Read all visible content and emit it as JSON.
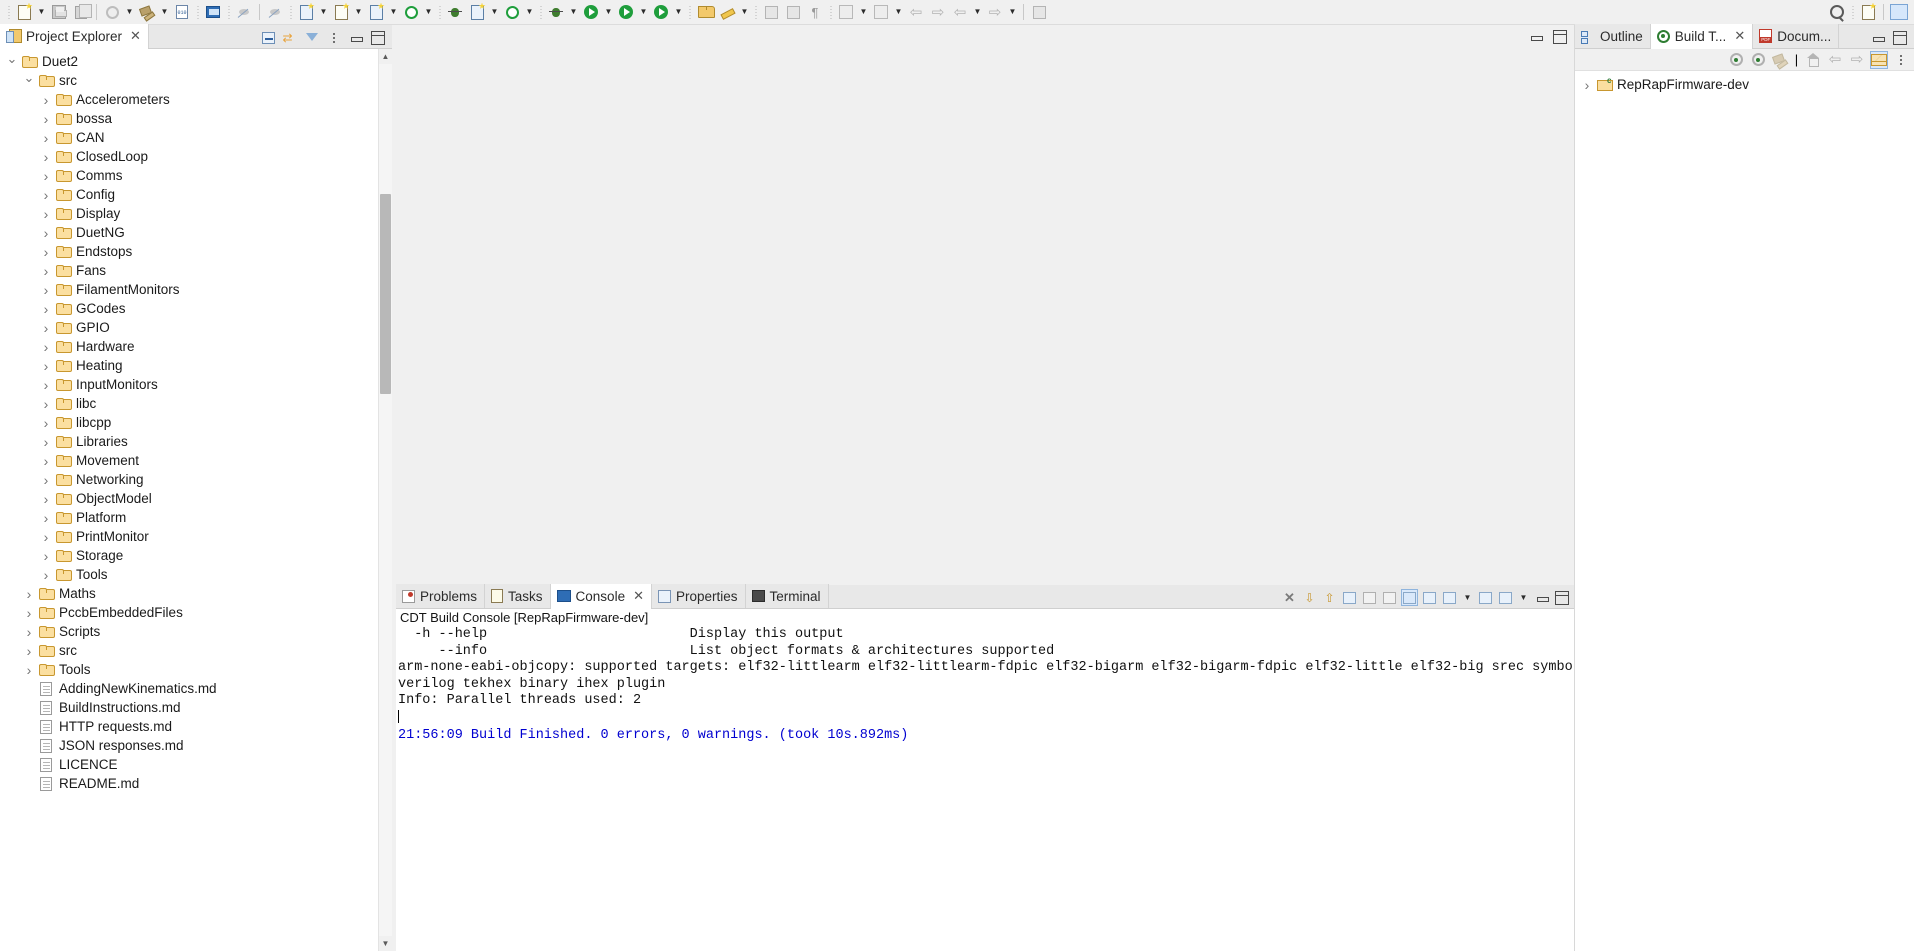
{
  "toolbar": {
    "items": [
      {
        "name": "new-wizard-icon",
        "glyph": "new-doc",
        "dropdown": true
      },
      {
        "name": "save-icon",
        "glyph": "floppy",
        "dropdown": false
      },
      {
        "name": "save-all-icon",
        "glyph": "copy",
        "dropdown": false
      },
      {
        "name": "build-all-icon",
        "glyph": "circleg",
        "dropdown": true
      },
      {
        "name": "build-hammer-icon",
        "glyph": "hammer",
        "dropdown": true
      },
      {
        "name": "binary-010-icon",
        "glyph": "bin010",
        "dropdown": false
      },
      {
        "name": "open-console-icon",
        "glyph": "monitor",
        "dropdown": false
      },
      {
        "name": "skip-breakpoints-icon",
        "glyph": "nodebug",
        "dropdown": false
      },
      {
        "name": "debug-step-icon",
        "glyph": "stepicon",
        "dropdown": false
      },
      {
        "name": "new-c-class-icon",
        "glyph": "doc-c",
        "dropdown": true
      },
      {
        "name": "new-c-source-folder-icon",
        "glyph": "doc-c2",
        "dropdown": true
      },
      {
        "name": "new-c-file-icon",
        "glyph": "doc-c3",
        "dropdown": true
      },
      {
        "name": "search-g-icon",
        "glyph": "g-star",
        "dropdown": true
      },
      {
        "name": "new-c-project-icon",
        "glyph": "doc-c4",
        "dropdown": true
      },
      {
        "name": "g-plugin-icon",
        "glyph": "g-star2",
        "dropdown": true
      },
      {
        "name": "debug-bug-icon",
        "glyph": "bug",
        "dropdown": true
      },
      {
        "name": "run-icon",
        "glyph": "run",
        "dropdown": true
      },
      {
        "name": "run-external-tools-icon",
        "glyph": "run-w",
        "dropdown": true
      },
      {
        "name": "run-config-icon",
        "glyph": "run-red",
        "dropdown": true
      },
      {
        "name": "open-resource-icon",
        "glyph": "folderopen",
        "dropdown": false
      },
      {
        "name": "edit-pencil-icon",
        "glyph": "pencil",
        "dropdown": true
      },
      {
        "name": "new-editor-icon",
        "glyph": "grey-rect",
        "dropdown": false
      },
      {
        "name": "toggle-block-selection-icon",
        "glyph": "grey-rect2",
        "dropdown": false
      },
      {
        "name": "show-whitespace-icon",
        "glyph": "pilcrow",
        "dropdown": false
      },
      {
        "name": "next-annotation-icon",
        "glyph": "arrow-down-doc",
        "dropdown": true
      },
      {
        "name": "previous-annotation-icon",
        "glyph": "arrow-up-doc",
        "dropdown": true
      },
      {
        "name": "back-history-icon",
        "glyph": "arrow-left-star",
        "dropdown": false
      },
      {
        "name": "forward-history-icon",
        "glyph": "arrow-right-star",
        "dropdown": false
      },
      {
        "name": "back-icon",
        "glyph": "arrow-left",
        "dropdown": true
      },
      {
        "name": "forward-icon",
        "glyph": "arrow-right",
        "dropdown": true
      },
      {
        "name": "new-window-icon",
        "glyph": "win",
        "dropdown": false
      }
    ],
    "right": [
      {
        "name": "quick-access-search-icon",
        "glyph": "search"
      },
      {
        "name": "open-perspective-icon",
        "glyph": "persp"
      },
      {
        "name": "c-cpp-perspective-icon",
        "glyph": "persp-active"
      }
    ]
  },
  "project_explorer": {
    "tab_label": "Project Explorer",
    "tab_close": "✕",
    "tools": [
      {
        "name": "collapse-all-button",
        "glyph": "collapse"
      },
      {
        "name": "link-with-editor-button",
        "glyph": "link"
      },
      {
        "name": "view-menu-filter-button",
        "glyph": "filter"
      },
      {
        "name": "view-menu-button",
        "glyph": "vmenu"
      },
      {
        "name": "minimize-view-button",
        "glyph": "min"
      },
      {
        "name": "maximize-view-button",
        "glyph": "max"
      }
    ],
    "tree": [
      {
        "label": "Duet2",
        "depth": 1,
        "twist": "open",
        "icon": "folder"
      },
      {
        "label": "src",
        "depth": 2,
        "twist": "open",
        "icon": "folder"
      },
      {
        "label": "Accelerometers",
        "depth": 3,
        "twist": "closed",
        "icon": "folder"
      },
      {
        "label": "bossa",
        "depth": 3,
        "twist": "closed",
        "icon": "folder"
      },
      {
        "label": "CAN",
        "depth": 3,
        "twist": "closed",
        "icon": "folder"
      },
      {
        "label": "ClosedLoop",
        "depth": 3,
        "twist": "closed",
        "icon": "folder"
      },
      {
        "label": "Comms",
        "depth": 3,
        "twist": "closed",
        "icon": "folder"
      },
      {
        "label": "Config",
        "depth": 3,
        "twist": "closed",
        "icon": "folder"
      },
      {
        "label": "Display",
        "depth": 3,
        "twist": "closed",
        "icon": "folder"
      },
      {
        "label": "DuetNG",
        "depth": 3,
        "twist": "closed",
        "icon": "folder"
      },
      {
        "label": "Endstops",
        "depth": 3,
        "twist": "closed",
        "icon": "folder"
      },
      {
        "label": "Fans",
        "depth": 3,
        "twist": "closed",
        "icon": "folder"
      },
      {
        "label": "FilamentMonitors",
        "depth": 3,
        "twist": "closed",
        "icon": "folder"
      },
      {
        "label": "GCodes",
        "depth": 3,
        "twist": "closed",
        "icon": "folder"
      },
      {
        "label": "GPIO",
        "depth": 3,
        "twist": "closed",
        "icon": "folder"
      },
      {
        "label": "Hardware",
        "depth": 3,
        "twist": "closed",
        "icon": "folder"
      },
      {
        "label": "Heating",
        "depth": 3,
        "twist": "closed",
        "icon": "folder"
      },
      {
        "label": "InputMonitors",
        "depth": 3,
        "twist": "closed",
        "icon": "folder"
      },
      {
        "label": "libc",
        "depth": 3,
        "twist": "closed",
        "icon": "folder"
      },
      {
        "label": "libcpp",
        "depth": 3,
        "twist": "closed",
        "icon": "folder"
      },
      {
        "label": "Libraries",
        "depth": 3,
        "twist": "closed",
        "icon": "folder"
      },
      {
        "label": "Movement",
        "depth": 3,
        "twist": "closed",
        "icon": "folder"
      },
      {
        "label": "Networking",
        "depth": 3,
        "twist": "closed",
        "icon": "folder"
      },
      {
        "label": "ObjectModel",
        "depth": 3,
        "twist": "closed",
        "icon": "folder"
      },
      {
        "label": "Platform",
        "depth": 3,
        "twist": "closed",
        "icon": "folder"
      },
      {
        "label": "PrintMonitor",
        "depth": 3,
        "twist": "closed",
        "icon": "folder"
      },
      {
        "label": "Storage",
        "depth": 3,
        "twist": "closed",
        "icon": "folder"
      },
      {
        "label": "Tools",
        "depth": 3,
        "twist": "closed",
        "icon": "folder"
      },
      {
        "label": "Maths",
        "depth": 2,
        "twist": "closed",
        "icon": "folder"
      },
      {
        "label": "PccbEmbeddedFiles",
        "depth": 2,
        "twist": "closed",
        "icon": "folder"
      },
      {
        "label": "Scripts",
        "depth": 2,
        "twist": "closed",
        "icon": "folder"
      },
      {
        "label": "src",
        "depth": 2,
        "twist": "closed",
        "icon": "folder"
      },
      {
        "label": "Tools",
        "depth": 2,
        "twist": "closed",
        "icon": "folder"
      },
      {
        "label": "AddingNewKinematics.md",
        "depth": 2,
        "twist": "none",
        "icon": "file"
      },
      {
        "label": "BuildInstructions.md",
        "depth": 2,
        "twist": "none",
        "icon": "file"
      },
      {
        "label": "HTTP requests.md",
        "depth": 2,
        "twist": "none",
        "icon": "file"
      },
      {
        "label": "JSON responses.md",
        "depth": 2,
        "twist": "none",
        "icon": "file"
      },
      {
        "label": "LICENCE",
        "depth": 2,
        "twist": "none",
        "icon": "file"
      },
      {
        "label": "README.md",
        "depth": 2,
        "twist": "none",
        "icon": "file"
      }
    ]
  },
  "editor": {
    "minimize_label": "minimize",
    "maximize_label": "maximize"
  },
  "console": {
    "tabs": [
      {
        "label": "Problems",
        "icon": "problems-icon",
        "active": false,
        "closable": false
      },
      {
        "label": "Tasks",
        "icon": "tasks-icon",
        "active": false,
        "closable": false
      },
      {
        "label": "Console",
        "icon": "console-icon",
        "active": true,
        "closable": true
      },
      {
        "label": "Properties",
        "icon": "properties-icon",
        "active": false,
        "closable": false
      },
      {
        "label": "Terminal",
        "icon": "terminal-icon",
        "active": false,
        "closable": false
      }
    ],
    "close_glyph": "✕",
    "title": "CDT Build Console [RepRapFirmware-dev]",
    "tools": [
      {
        "name": "terminate-button",
        "glyph": "x-red"
      },
      {
        "name": "scroll-down-button",
        "glyph": "arrow-down"
      },
      {
        "name": "scroll-up-button",
        "glyph": "arrow-up"
      },
      {
        "name": "clear-console-button",
        "glyph": "clear"
      },
      {
        "name": "toggle-word-wrap-button",
        "glyph": "wrap"
      },
      {
        "name": "scroll-lock-button",
        "glyph": "lock"
      },
      {
        "name": "show-console-when-output-button",
        "glyph": "show1"
      },
      {
        "name": "pin-console-button",
        "glyph": "pin"
      },
      {
        "name": "display-selected-console-button",
        "glyph": "disp"
      },
      {
        "name": "new-console-view-button",
        "glyph": "newcons"
      },
      {
        "name": "open-console-dropdown",
        "glyph": "opencons"
      },
      {
        "name": "minimize-console-button",
        "glyph": "min"
      },
      {
        "name": "maximize-console-button",
        "glyph": "max"
      }
    ],
    "lines": [
      {
        "text": "  -h --help                         Display this output",
        "color": "black"
      },
      {
        "text": "     --info                         List object formats & architectures supported",
        "color": "black"
      },
      {
        "text": "arm-none-eabi-objcopy: supported targets: elf32-littlearm elf32-littlearm-fdpic elf32-bigarm elf32-bigarm-fdpic elf32-little elf32-big srec symbolsrec",
        "color": "black"
      },
      {
        "text": "verilog tekhex binary ihex plugin",
        "color": "black"
      },
      {
        "text": "Info: Parallel threads used: 2",
        "color": "black"
      },
      {
        "text": "",
        "color": "black"
      },
      {
        "text": "21:56:09 Build Finished. 0 errors, 0 warnings. (took 10s.892ms)",
        "color": "blue"
      }
    ]
  },
  "right_panel": {
    "tabs": [
      {
        "label": "Outline",
        "icon": "outline-icon",
        "active": false,
        "closable": false
      },
      {
        "label": "Build T...",
        "icon": "build-target-icon",
        "active": true,
        "closable": true
      },
      {
        "label": "Docum...",
        "icon": "pdf-icon",
        "active": false,
        "closable": false
      }
    ],
    "close_glyph": "✕",
    "tools": [
      {
        "name": "add-build-target-button",
        "glyph": "target-add"
      },
      {
        "name": "edit-build-target-button",
        "glyph": "target-edit"
      },
      {
        "name": "build-target-button",
        "glyph": "hammer-grey"
      },
      {
        "name": "home-button",
        "glyph": "home"
      },
      {
        "name": "back-button",
        "glyph": "left"
      },
      {
        "name": "forward-button",
        "glyph": "right"
      },
      {
        "name": "hide-empty-folders-button",
        "glyph": "envelope",
        "selected": true
      },
      {
        "name": "view-menu-button",
        "glyph": "vmenu"
      }
    ],
    "window_buttons": [
      {
        "name": "minimize-view-button",
        "glyph": "min"
      },
      {
        "name": "maximize-view-button",
        "glyph": "max"
      }
    ],
    "tree": [
      {
        "label": "RepRapFirmware-dev",
        "depth": 1,
        "twist": "closed",
        "icon": "project-c"
      }
    ]
  }
}
